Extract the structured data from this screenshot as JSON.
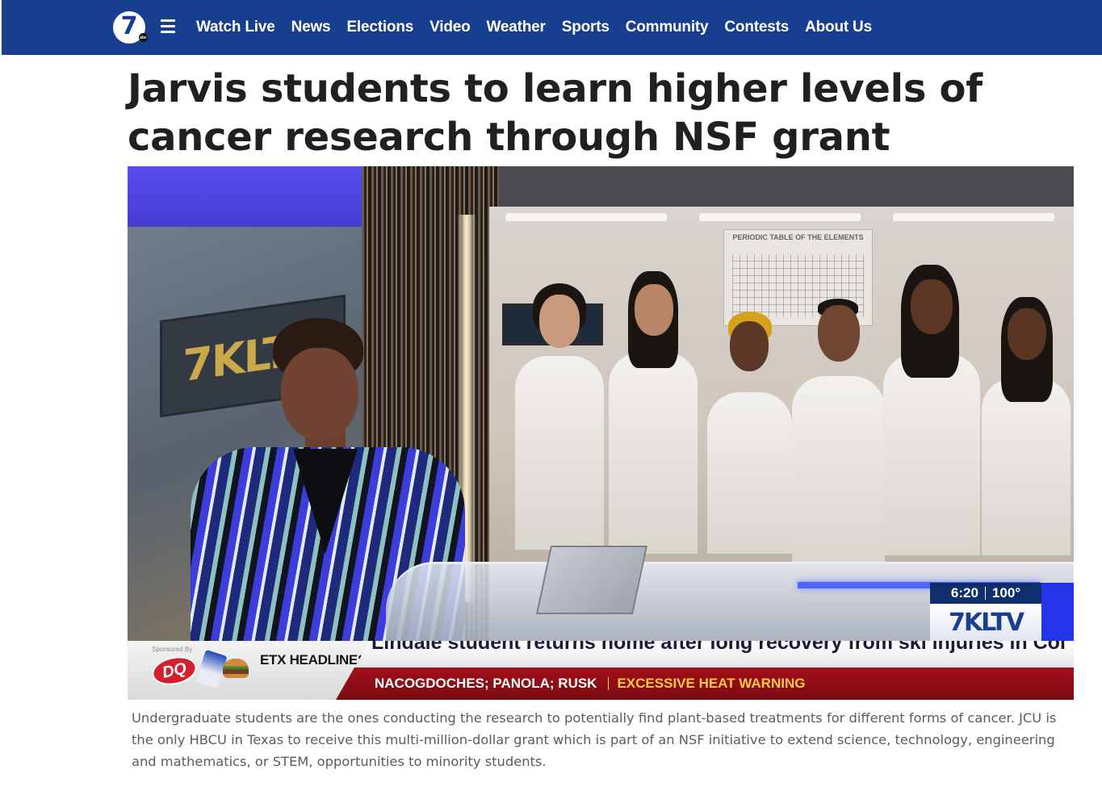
{
  "nav": {
    "logo": {
      "number": "7",
      "badge": "abc"
    },
    "menu_icon": "hamburger-icon",
    "items": [
      "Watch Live",
      "News",
      "Elections",
      "Video",
      "Weather",
      "Sports",
      "Community",
      "Contests",
      "About Us"
    ],
    "background": "#183e8f"
  },
  "article": {
    "headline": "Jarvis students to learn higher levels of cancer research through NSF grant",
    "caption": "Undergraduate students are the ones conducting the research to potentially find plant-based treatments for different forms of cancer. JCU is the only HBCU in Texas to receive this multi-million-dollar grant which is part of an NSF initiative to extend science, technology, engineering and mathematics, or STEM, opportunities to minority students."
  },
  "video": {
    "studio_sign": "7KLTV",
    "periodic_table": "PERIODIC TABLE OF THE ELEMENTS",
    "bug": {
      "time": "6:20",
      "temp": "100°",
      "logo": "7KLTV"
    },
    "ticker": {
      "sponsor": "Sponsored By",
      "sponsor_logo": "DQ",
      "section": "ETX HEADLINES",
      "scroll": "Lindale student returns home after long recovery from ski injuries in Col",
      "counties": "NACOGDOCHES; PANOLA; RUSK",
      "alert": "EXCESSIVE HEAT WARNING"
    }
  }
}
